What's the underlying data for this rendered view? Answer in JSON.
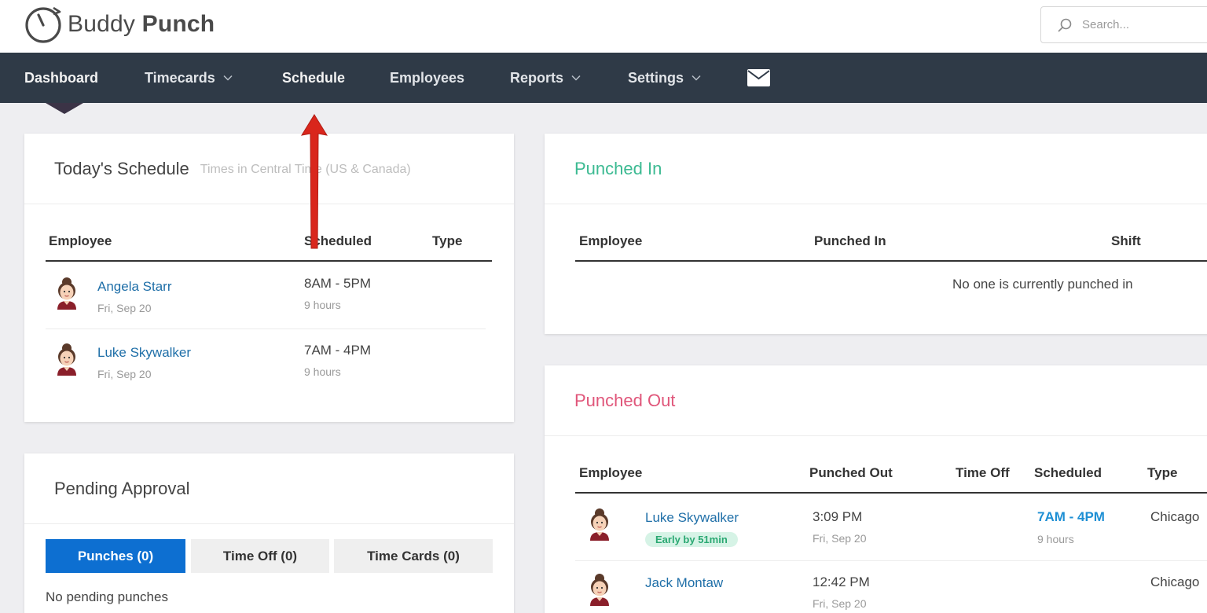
{
  "app": {
    "logo_text_1": "Buddy",
    "logo_text_2": "Punch"
  },
  "search": {
    "placeholder": "Search..."
  },
  "nav": {
    "dashboard": "Dashboard",
    "timecards": "Timecards",
    "schedule": "Schedule",
    "employees": "Employees",
    "reports": "Reports",
    "settings": "Settings",
    "mail_icon": "envelope-icon"
  },
  "todays_schedule": {
    "title": "Today's Schedule",
    "subtitle": "Times in Central Time (US & Canada)",
    "columns": [
      "Employee",
      "Scheduled",
      "Type"
    ],
    "rows": [
      {
        "name": "Angela Starr",
        "date": "Fri, Sep 20",
        "time": "8AM - 5PM",
        "hours": "9 hours"
      },
      {
        "name": "Luke Skywalker",
        "date": "Fri, Sep 20",
        "time": "7AM - 4PM",
        "hours": "9 hours"
      }
    ]
  },
  "punched_in": {
    "title": "Punched In",
    "columns": [
      "Employee",
      "Punched In",
      "Shift"
    ],
    "empty": "No one is currently punched in"
  },
  "punched_out": {
    "title": "Punched Out",
    "columns": [
      "Employee",
      "Punched Out",
      "Time Off",
      "Scheduled",
      "Type"
    ],
    "rows": [
      {
        "name": "Luke Skywalker",
        "badge": "Early by 51min",
        "time": "3:09 PM",
        "date": "Fri, Sep 20",
        "scheduled": "7AM - 4PM",
        "hours": "9 hours",
        "type": "Chicago"
      },
      {
        "name": "Jack Montaw",
        "time": "12:42 PM",
        "date": "Fri, Sep 20",
        "type": "Chicago"
      }
    ]
  },
  "pending": {
    "title": "Pending Approval",
    "tabs": [
      "Punches (0)",
      "Time Off (0)",
      "Time Cards (0)"
    ],
    "empty": "No pending punches"
  },
  "colors": {
    "nav_bg": "#2f3a47",
    "punched_in": "#3cba92",
    "punched_out": "#e0567a",
    "link": "#1f6fa8",
    "tab_active": "#0d6fd1",
    "annotation_arrow": "#d9261c"
  }
}
